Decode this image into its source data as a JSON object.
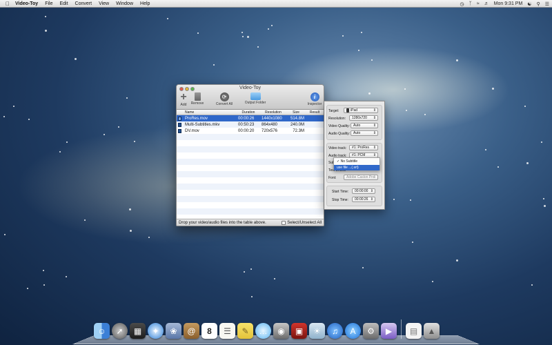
{
  "menubar": {
    "app_name": "Video-Toy",
    "items": [
      "File",
      "Edit",
      "Convert",
      "View",
      "Window",
      "Help"
    ],
    "clock": "Mon 9:31 PM"
  },
  "window": {
    "title": "Video-Toy",
    "toolbar": {
      "add": "Add",
      "remove": "Remove",
      "convert_all": "Convert All",
      "output_folder": "Output Folder",
      "inspector": "Inspector"
    },
    "columns": [
      "Name",
      "Duration",
      "Resolution",
      "Size",
      "Result"
    ],
    "rows": [
      {
        "name": "ProRes.mov",
        "duration": "00:00:26",
        "resolution": "1440x1080",
        "size": "514.8M",
        "result": ""
      },
      {
        "name": "Multi-Subtitles.mkv",
        "duration": "00:50:23",
        "resolution": "864x480",
        "size": "240.0M",
        "result": ""
      },
      {
        "name": "DV.mov",
        "duration": "00:00:20",
        "resolution": "720x576",
        "size": "72.3M",
        "result": ""
      }
    ],
    "status_text": "Drop your video/audio files into the table above.",
    "select_all_label": "Select/Unselect All"
  },
  "inspector": {
    "target_label": "Target:",
    "target_value": "iPad",
    "resolution_label": "Resolution:",
    "resolution_value": "1280x720",
    "video_quality_label": "Video Quality:",
    "video_quality_value": "Auto",
    "audio_quality_label": "Audio Quality:",
    "audio_quality_value": "Auto",
    "video_track_label": "Video track:",
    "video_track_value": "#1: ProRes",
    "audio_track_label": "Audio track:",
    "audio_track_value": "#1: PCM",
    "subtitle_label": "Subtitle:",
    "text_encoding_label": "Text Encod",
    "font_label": "Font:",
    "font_value": "Adobe Caslon Pro",
    "start_time_label": "Start Time:",
    "start_time_value": "00:00:00",
    "stop_time_label": "Stop Time:",
    "stop_time_value": "00:00:26",
    "subtitle_menu": {
      "options": [
        "✓ No Subtitle",
        "use file ...(.srt)"
      ],
      "highlighted_index": 1
    }
  },
  "dock": {
    "icons": [
      "finder-icon",
      "rocket-icon",
      "dashboard-icon",
      "safari-icon",
      "mail-stamp-icon",
      "contacts-icon",
      "calendar-icon",
      "reminders-icon",
      "notes-icon",
      "messages-icon",
      "facetime-icon",
      "photo-booth-icon",
      "iphoto-icon",
      "itunes-icon",
      "app-store-icon",
      "system-preferences-icon",
      "video-toy-icon",
      "document-icon",
      "trash-icon"
    ],
    "calendar_day": "8"
  },
  "colors": {
    "selection": "#2f67c9",
    "desktop": "#1e3a60"
  }
}
